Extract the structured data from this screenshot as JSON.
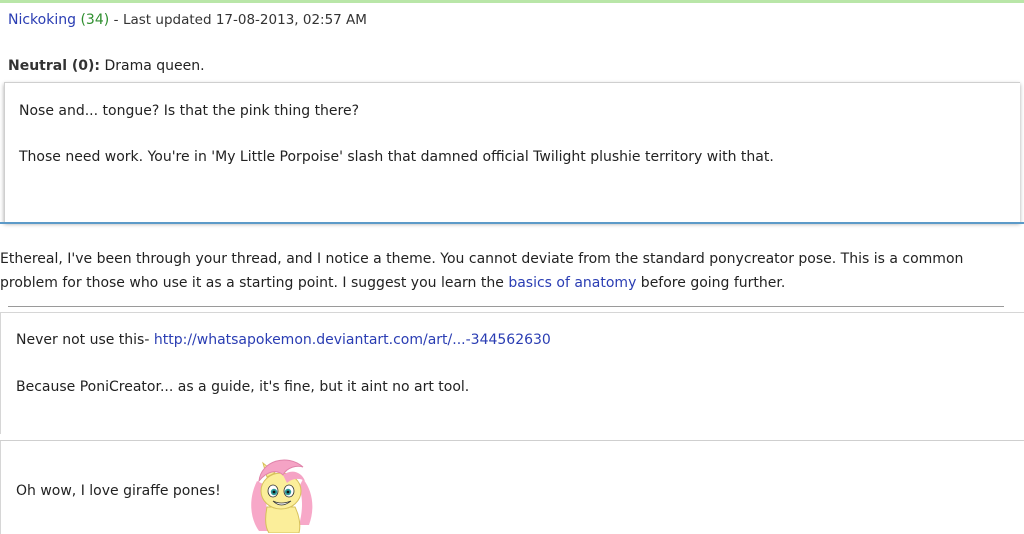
{
  "post": {
    "username": "Nickoking",
    "post_count": "(34)",
    "meta_separator": "-",
    "last_updated": "Last updated 17-08-2013, 02:57 AM",
    "reputation_label": "Neutral (0):",
    "reputation_text": "Drama queen."
  },
  "quote1": {
    "line1": "Nose and... tongue? Is that the pink thing there?",
    "line2": "Those need work. You're in 'My Little Porpoise' slash that damned official Twilight plushie territory with that."
  },
  "body": {
    "text_before_link": "Ethereal, I've been through your thread, and I notice a theme. You cannot deviate from the standard ponycreator pose. This is a common problem for those who use it as a starting point. I suggest you learn the ",
    "link_text": "basics of anatomy",
    "text_after_link": " before going further."
  },
  "quote2": {
    "line1_prefix": "Never not use this- ",
    "line1_link": "http://whatsapokemon.deviantart.com/art/...-344562630",
    "line2": "Because PoniCreator... as a guide, it's fine, but it aint no art tool."
  },
  "reply": {
    "text": "Oh wow, I love giraffe pones!",
    "emoticon": "fluttershy-pony-emoticon"
  },
  "colors": {
    "link": "#2a3db3",
    "post_count": "#2f8f2f",
    "top_bar": "#b9e6a8",
    "quote_shadow": "#5c9ac8"
  }
}
